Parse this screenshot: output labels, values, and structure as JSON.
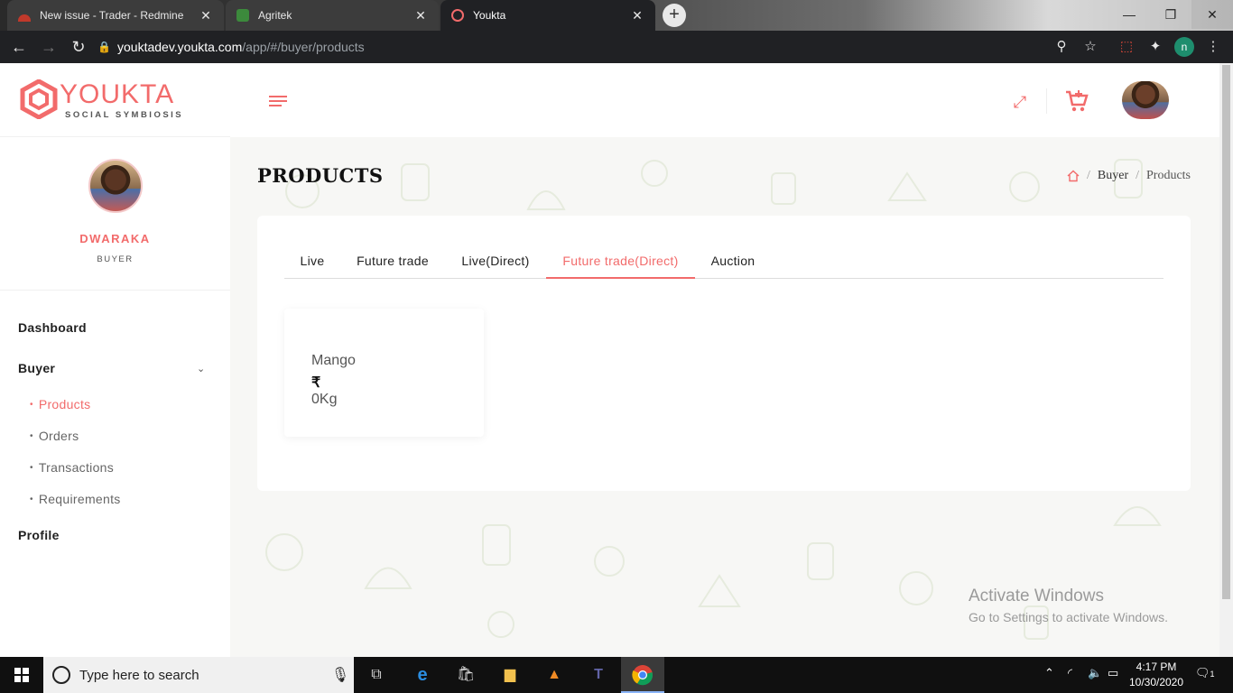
{
  "browser": {
    "tabs": [
      {
        "title": "New issue - Trader - Redmine"
      },
      {
        "title": "Agritek"
      },
      {
        "title": "Youkta"
      }
    ],
    "url_host": "youktadev.youkta.com",
    "url_path": "/app/#/buyer/products",
    "profile_initial": "n"
  },
  "brand": {
    "name": "YOUKTA",
    "tagline": "SOCIAL SYMBIOSIS",
    "accent_color": "#f26b6b"
  },
  "user": {
    "name": "DWARAKA",
    "role": "BUYER"
  },
  "sidebar": {
    "dashboard": "Dashboard",
    "buyer": "Buyer",
    "buyer_items": [
      {
        "label": "Products"
      },
      {
        "label": "Orders"
      },
      {
        "label": "Transactions"
      },
      {
        "label": "Requirements"
      }
    ],
    "profile": "Profile"
  },
  "page": {
    "title": "PRODUCTS",
    "breadcrumb": [
      "Buyer",
      "Products"
    ]
  },
  "tabs": [
    {
      "label": "Live"
    },
    {
      "label": "Future trade"
    },
    {
      "label": "Live(Direct)"
    },
    {
      "label": "Future trade(Direct)"
    },
    {
      "label": "Auction"
    }
  ],
  "active_tab": "Future trade(Direct)",
  "products": [
    {
      "name": "Mango",
      "currency": "₹",
      "quantity": "0Kg"
    }
  ],
  "watermark": {
    "line1": "Activate Windows",
    "line2": "Go to Settings to activate Windows."
  },
  "taskbar": {
    "search_placeholder": "Type here to search",
    "time": "4:17 PM",
    "date": "10/30/2020",
    "notification_count": "1"
  }
}
